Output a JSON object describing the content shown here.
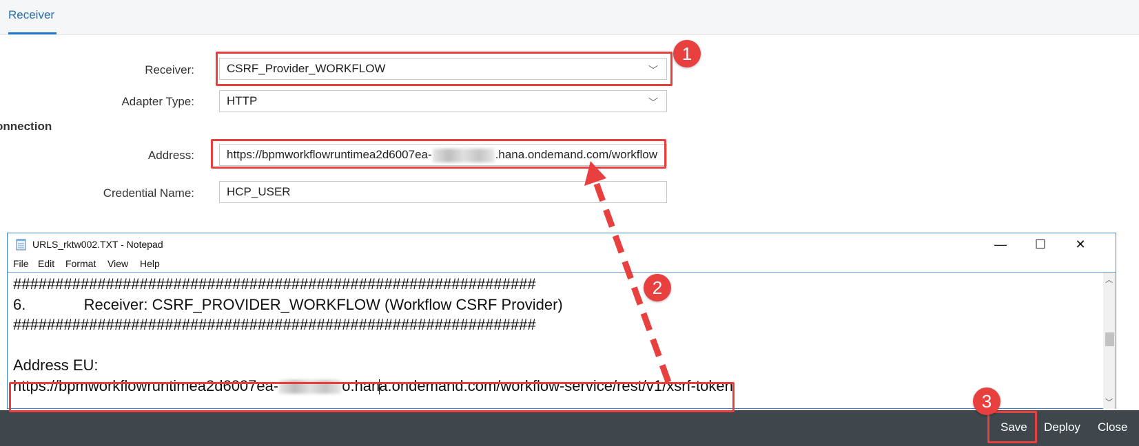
{
  "tab": {
    "label": "Receiver"
  },
  "form": {
    "receiver_label": "Receiver:",
    "receiver_value": "CSRF_Provider_WORKFLOW",
    "adapter_label": "Adapter Type:",
    "adapter_value": "HTTP",
    "section_title": "onnection",
    "address_label": "Address:",
    "address_prefix": "https://bpmworkflowruntimea2d6007ea-",
    "address_suffix": ".hana.ondemand.com/workflow",
    "credential_label": "Credential Name:",
    "credential_value": "HCP_USER"
  },
  "notepad": {
    "title": "URLS_rktw002.TXT - Notepad",
    "menu": [
      "File",
      "Edit",
      "Format",
      "View",
      "Help"
    ],
    "window_buttons": {
      "minimize": "—",
      "maximize": "☐",
      "close": "✕"
    },
    "lines": {
      "hash1": "##############################################################",
      "item_number": "6.",
      "item_text": "Receiver: CSRF_PROVIDER_WORKFLOW  (Workflow CSRF Provider)",
      "hash2": "##############################################################",
      "address_heading": "Address EU:",
      "url_prefix": "https://bpmworkflowruntimea2d6007ea-",
      "url_mid": "o.han",
      "url_suffix": "a.ondemand.com/workflow-service/rest/v1/xsrf-token"
    }
  },
  "badges": {
    "one": "1",
    "two": "2",
    "three": "3"
  },
  "footer": {
    "save": "Save",
    "deploy": "Deploy",
    "close": "Close"
  },
  "colors": {
    "accent": "#1f79c9",
    "highlight": "#e8403f",
    "footer_bg": "#3f464c"
  }
}
